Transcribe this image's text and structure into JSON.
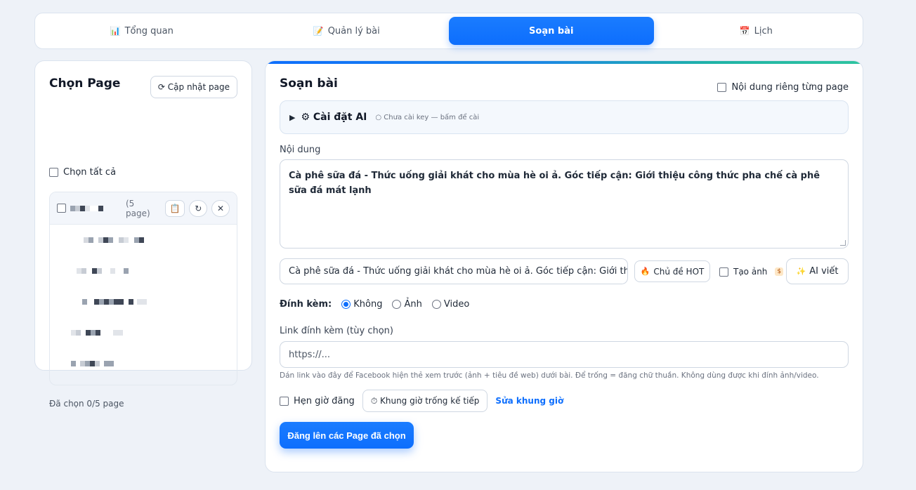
{
  "tabs": [
    {
      "icon": "📊",
      "label": "Tổng quan"
    },
    {
      "icon": "📝",
      "label": "Quản lý bài"
    },
    {
      "icon": "",
      "label": "Soạn bài"
    },
    {
      "icon": "📅",
      "label": "Lịch"
    }
  ],
  "left": {
    "title": "Chọn Page",
    "refresh_label": "⟳ Cập nhật page",
    "select_all_label": "Chọn tất cả",
    "group_count": "(5 page)",
    "group_btn_copy": "📋",
    "group_btn_refresh": "↻",
    "group_btn_close": "✕",
    "selected_count": "Đã chọn 0/5 page"
  },
  "compose": {
    "title": "Soạn bài",
    "custom_each_label": "Nội dung riêng từng page",
    "ai": {
      "toggle": "▶",
      "title": "⚙ Cài đặt AI",
      "status": "○ Chưa cài key — bấm để cài"
    },
    "content_label": "Nội dung",
    "content_text": "Cà phê sữa đá - Thức uống giải khát cho mùa hè oi ả. Góc tiếp cận: Giới thiệu công thức pha chế cà phê sữa đá mát lạnh",
    "topic_value": "Cà phê sữa đá - Thức uống giải khát cho mùa hè oi ả. Góc tiếp cận: Giới thiệu công thức pha chế cà phê sữa đá mát lạnh",
    "hot_label": "Chủ đề HOT",
    "hot_icon": "🔥",
    "create_image_label": "Tạo ảnh",
    "create_image_badge": "$",
    "ai_write_label": "AI viết",
    "ai_write_icon": "✨",
    "attach_label": "Đính kèm:",
    "attach_options": [
      "Không",
      "Ảnh",
      "Video"
    ],
    "link_label": "Link đính kèm (tùy chọn)",
    "link_placeholder": "https://...",
    "link_hint": "Dán link vào đây để Facebook hiện thẻ xem trước (ảnh + tiêu đề web) dưới bài. Để trống = đăng chữ thuần. Không dùng được khi đính ảnh/video.",
    "schedule_label": "Hẹn giờ đăng",
    "next_slot_label": "⏱ Khung giờ trống kế tiếp",
    "edit_slot_label": "Sửa khung giờ",
    "post_label": "Đăng lên các Page đã chọn"
  },
  "colors": {
    "accent": "#0d6efd",
    "background": "#eef2f8"
  }
}
